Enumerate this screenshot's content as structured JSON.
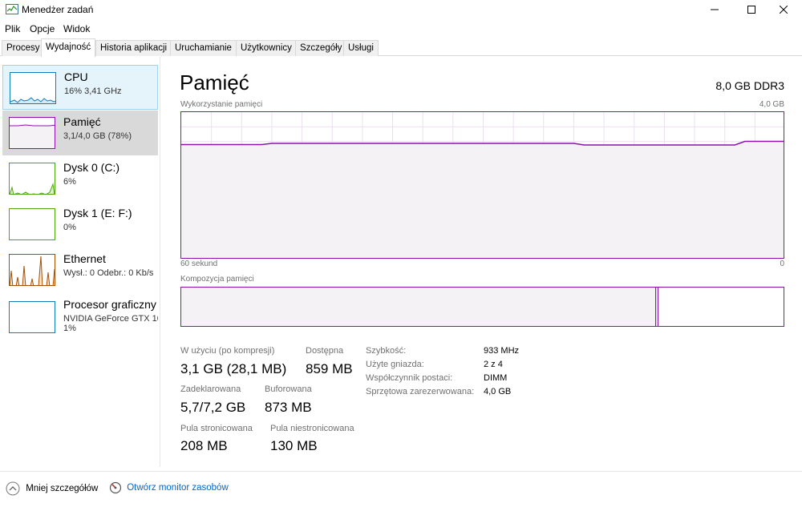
{
  "window": {
    "title": "Menedżer zadań"
  },
  "menu": [
    "Plik",
    "Opcje",
    "Widok"
  ],
  "tabs": [
    {
      "label": "Procesy"
    },
    {
      "label": "Wydajność"
    },
    {
      "label": "Historia aplikacji"
    },
    {
      "label": "Uruchamianie"
    },
    {
      "label": "Użytkownicy"
    },
    {
      "label": "Szczegóły"
    },
    {
      "label": "Usługi"
    }
  ],
  "resources": [
    {
      "name": "CPU",
      "sub": "16% 3,41 GHz"
    },
    {
      "name": "Pamięć",
      "sub": "3,1/4,0 GB (78%)"
    },
    {
      "name": "Dysk 0 (C:)",
      "sub": "6%"
    },
    {
      "name": "Dysk 1 (E: F:)",
      "sub": "0%"
    },
    {
      "name": "Ethernet",
      "sub": "Wysł.: 0 Odebr.: 0 Kb/s"
    },
    {
      "name": "Procesor graficzny",
      "sub": "NVIDIA GeForce GTX 10",
      "sub2": "1%"
    }
  ],
  "main": {
    "title": "Pamięć",
    "spec": "8,0 GB DDR3",
    "usage_label": "Wykorzystanie pamięci",
    "usage_max": "4,0 GB",
    "time_label": "60 sekund",
    "time_min": "0",
    "composition_label": "Kompozycja pamięci",
    "usage_level": 0.78,
    "composition_used_fraction": 0.788
  },
  "stats": {
    "in_use_label": "W użyciu (po kompresji)",
    "in_use_value": "3,1 GB (28,1 MB)",
    "available_label": "Dostępna",
    "available_value": "859 MB",
    "committed_label": "Zadeklarowana",
    "committed_value": "5,7/7,2 GB",
    "cached_label": "Buforowana",
    "cached_value": "873 MB",
    "paged_label": "Pula stronicowana",
    "paged_value": "208 MB",
    "nonpaged_label": "Pula niestronicowana",
    "nonpaged_value": "130 MB"
  },
  "details": [
    {
      "label": "Szybkość:",
      "value": "933 MHz"
    },
    {
      "label": "Użyte gniazda:",
      "value": "2 z 4"
    },
    {
      "label": "Współczynnik postaci:",
      "value": "DIMM"
    },
    {
      "label": "Sprzętowa zarezerwowana:",
      "value": "4,0 GB"
    }
  ],
  "footer": {
    "less_details": "Mniej szczegółów",
    "resource_monitor": "Otwórz monitor zasobów"
  },
  "colors": {
    "memory": "#8b12ae",
    "cpu": "#117dbb",
    "disk": "#4da60c",
    "ethernet": "#a74f01",
    "gpu": "#117dbb"
  }
}
